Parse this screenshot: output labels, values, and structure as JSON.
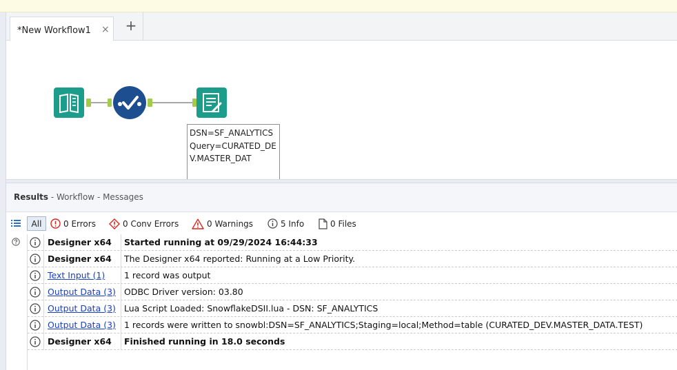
{
  "tabs": [
    {
      "label": "*New Workflow1",
      "close": "×"
    }
  ],
  "tab_add": "+",
  "canvas": {
    "annotation": "DSN=SF_ANALYTICS Query=CURATED_DEV.MASTER_DAT",
    "tools": [
      "text-input-tool",
      "check-tool",
      "output-data-tool"
    ],
    "colors": {
      "text_input": "#1c9c8a",
      "check": "#1d4e8f",
      "output": "#1c9c8a",
      "connector": "#a4cc4b"
    }
  },
  "results": {
    "title": "Results",
    "subtitle": " - Workflow - Messages"
  },
  "filters": {
    "all": "All",
    "errors": "0 Errors",
    "conv_errors": "0 Conv Errors",
    "warnings": "0 Warnings",
    "info": "5 Info",
    "files": "0 Files"
  },
  "messages": [
    {
      "tool": "Designer x64",
      "message": "Started running at 09/29/2024 16:44:33",
      "tool_style": "bold",
      "msg_style": "bold"
    },
    {
      "tool": "Designer x64",
      "message": "The Designer x64 reported: Running at a Low Priority.",
      "tool_style": "bold",
      "msg_style": "normal"
    },
    {
      "tool": "Text Input (1)",
      "message": "1 record was output",
      "tool_style": "link",
      "msg_style": "normal"
    },
    {
      "tool": "Output Data (3)",
      "message": "ODBC Driver version: 03.80",
      "tool_style": "link",
      "msg_style": "normal"
    },
    {
      "tool": "Output Data (3)",
      "message": "Lua Script Loaded: SnowflakeDSII.lua - DSN: SF_ANALYTICS",
      "tool_style": "link",
      "msg_style": "normal"
    },
    {
      "tool": "Output Data (3)",
      "message": "1 records were written to snowbl:DSN=SF_ANALYTICS;Staging=local;Method=table (CURATED_DEV.MASTER_DATA.TEST)",
      "tool_style": "link",
      "msg_style": "normal"
    },
    {
      "tool": "Designer x64",
      "message": "Finished running in 18.0 seconds",
      "tool_style": "bold",
      "msg_style": "bold"
    }
  ]
}
